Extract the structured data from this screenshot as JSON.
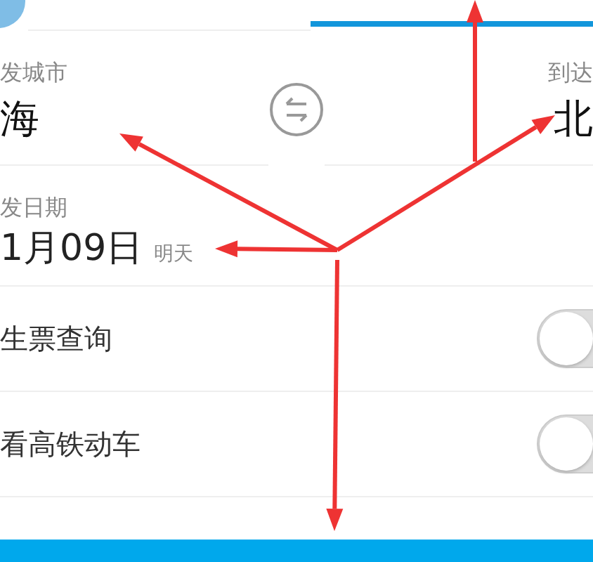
{
  "tabs": [
    {
      "selected": false
    },
    {
      "selected": true
    }
  ],
  "origin": {
    "label": "发城市",
    "value": "海"
  },
  "destination": {
    "label": "到达",
    "value": "北"
  },
  "date": {
    "label": "发日期",
    "value": "1月09日",
    "note": "明天"
  },
  "options": [
    {
      "label": "生票查询",
      "on": false
    },
    {
      "label": "看高铁动车",
      "on": false
    }
  ],
  "annotations": [
    {
      "kind": "arrow"
    },
    {
      "kind": "arrow"
    },
    {
      "kind": "arrow"
    },
    {
      "kind": "arrow"
    },
    {
      "kind": "arrow"
    }
  ]
}
